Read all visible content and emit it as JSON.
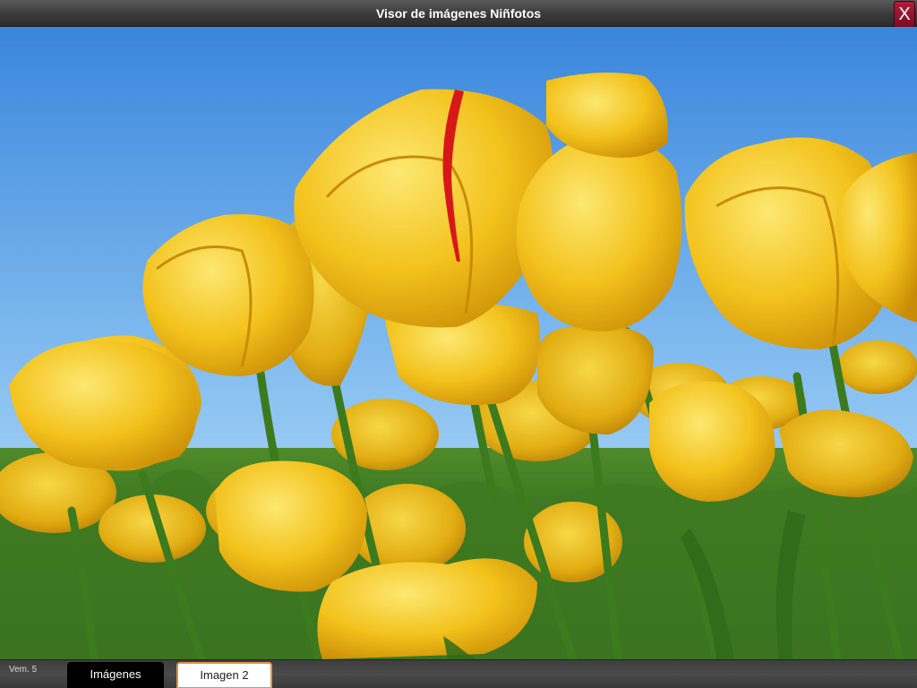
{
  "window": {
    "title": "Visor de imágenes Niñfotos",
    "close_label": "X"
  },
  "viewer": {
    "image_subject": "yellow tulips under blue sky"
  },
  "footer": {
    "version": "Vem. 5",
    "tabs": [
      {
        "label": "Imágenes",
        "active": false
      },
      {
        "label": "Imagen 2",
        "active": true
      }
    ]
  },
  "colors": {
    "sky_top": "#3f8fe0",
    "sky_bottom": "#b9dcf6",
    "tulip": "#f2c21a",
    "tulip_shadow": "#d49a0a",
    "tab_highlight": "#e3924a",
    "close_button": "#9a1530"
  }
}
